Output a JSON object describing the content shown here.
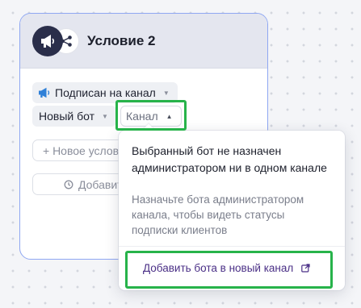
{
  "node": {
    "title": "Условие 2",
    "condition_chip": {
      "label": "Подписан на канал"
    },
    "bot_select": {
      "label": "Новый бот"
    },
    "channel_select": {
      "label": "Канал"
    },
    "new_condition_button": {
      "label": "+ Новое услов"
    },
    "add_button": {
      "label": "Добавит"
    }
  },
  "popover": {
    "title": "Выбранный бот не назначен администратором ни в одном канале",
    "description": "Назначьте бота администратором канала, чтобы видеть статусы подписки клиентов",
    "action_label": "Добавить бота в новый канал"
  },
  "colors": {
    "accent_border": "#8fa7f2",
    "highlight": "#27b34a",
    "action_text": "#4a2f86",
    "megaphone_bg": "#2a2e4a"
  }
}
